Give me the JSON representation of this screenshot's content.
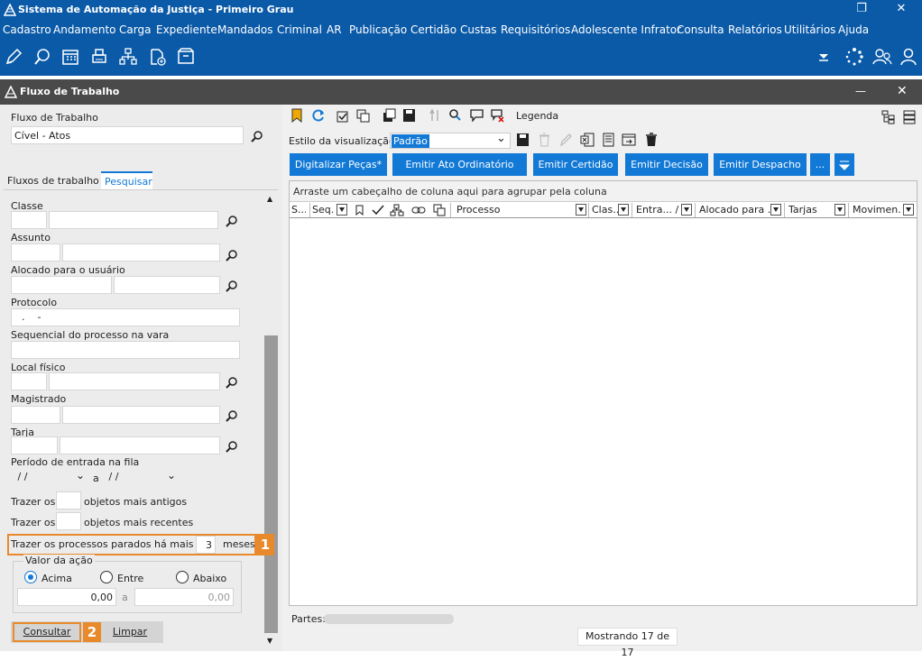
{
  "window": {
    "title": "Sistema de Automação da Justiça - Primeiro Grau",
    "restore": "❐",
    "close": "✕"
  },
  "menu": [
    "Cadastro",
    "Andamento",
    "Carga",
    "Expediente",
    "Mandados",
    "Criminal",
    "AR",
    "Publicação",
    "Certidão",
    "Custas",
    "Requisitórios",
    "Adolescente Infrator",
    "Consulta",
    "Relatórios",
    "Utilitários",
    "Ajuda"
  ],
  "subwindow": {
    "title": "Fluxo de Trabalho",
    "minimize": "—",
    "close": "✕"
  },
  "left": {
    "fluxo_label": "Fluxo de Trabalho",
    "fluxo_value": "Cível - Atos",
    "tab_fluxos": "Fluxos de trabalho",
    "tab_pesquisar": "Pesquisar",
    "classe": "Classe",
    "assunto": "Assunto",
    "alocado": "Alocado para o usuário",
    "protocolo": "Protocolo",
    "protocolo_mask": "  .    -",
    "sequencial": "Sequencial do processo na vara",
    "local": "Local físico",
    "magistrado": "Magistrado",
    "tarja": "Tarja",
    "periodo": "Período de entrada na fila",
    "date_from": " / /",
    "date_sep": "a",
    "date_to": " / /",
    "trazer": "Trazer os",
    "antigos": "objetos mais antigos",
    "recentes": "objetos mais recentes",
    "parados": "Trazer os processos parados há mais de",
    "parados_value": "3",
    "meses": "meses",
    "valor_legend": "Valor da ação",
    "acima": "Acima",
    "entre": "Entre",
    "abaixo": "Abaixo",
    "valor_a": "a",
    "valor1": "0,00",
    "valor2": "0,00",
    "consultar": "Consultar",
    "limpar": "Limpar",
    "badge1": "1",
    "badge2": "2"
  },
  "right": {
    "legenda": "Legenda",
    "estilo_label": "Estilo da visualização",
    "estilo_value": "Padrão",
    "buttons": [
      "Digitalizar Peças*",
      "Emitir Ato Ordinatório",
      "Emitir Certidão",
      "Emitir Decisão",
      "Emitir Despacho",
      "..."
    ],
    "group_hint": "Arraste um cabeçalho de coluna aqui para agrupar pela coluna",
    "columns": [
      "S...",
      "Seq.",
      "Processo",
      "Clas...",
      "Entra... /",
      "Alocado para ...",
      "Tarjas",
      "Movimen..."
    ],
    "partes": "Partes:",
    "mostrando": "Mostrando 17 de 17"
  },
  "colors": {
    "brand": "#0b5aa8",
    "button": "#1279d6",
    "highlight": "#e88a2c"
  }
}
